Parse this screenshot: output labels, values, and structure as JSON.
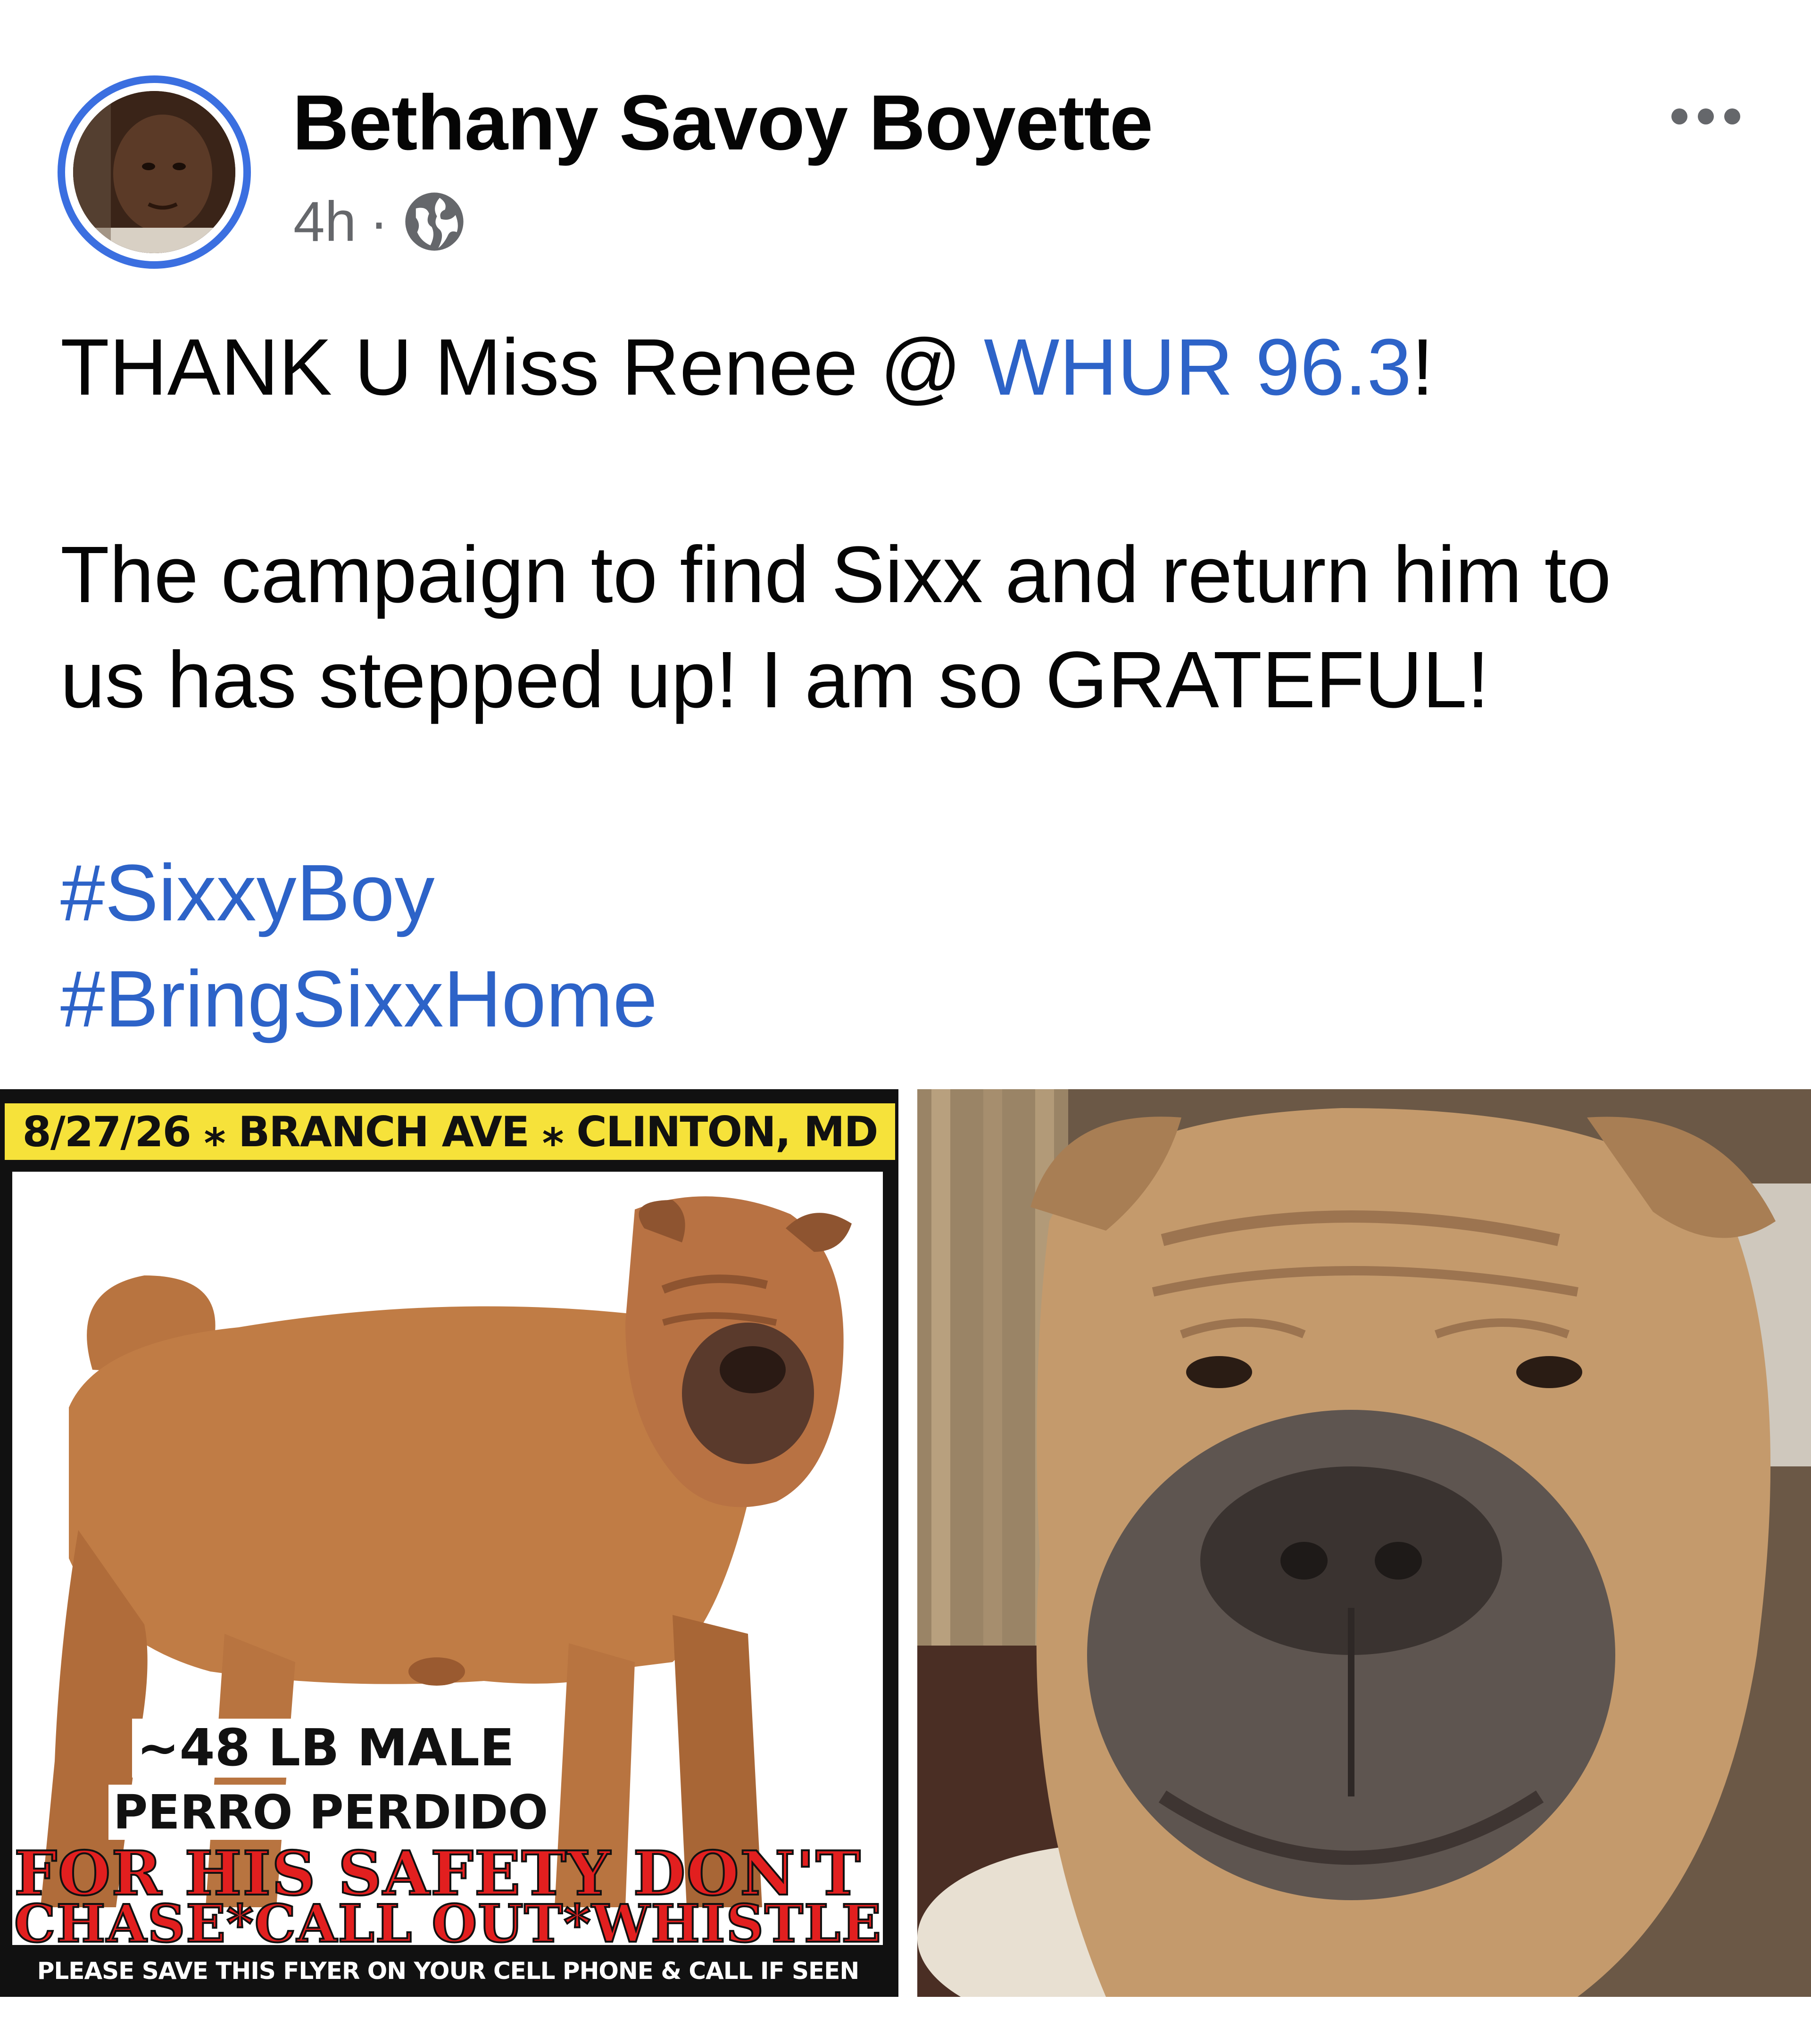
{
  "post": {
    "author_name": "Bethany Savoy Boyette",
    "timestamp": "4h",
    "separator": "·",
    "privacy_icon": "globe-icon",
    "more_icon": "ellipsis-icon",
    "text_line1_prefix": "THANK U Miss Renee @ ",
    "text_line1_link": "WHUR 96.3",
    "text_line1_suffix": "!",
    "text_line2": "The campaign to find Sixx and return him to",
    "text_line3": "us has stepped up! I am so GRATEFUL!",
    "hashtags": [
      "#SixxyBoy",
      "#BringSixxHome"
    ]
  },
  "flyer": {
    "header": "8/27/26 ⁎ BRANCH AVE ⁎ CLINTON, MD",
    "weight": "~48 LB MALE",
    "perro": "PERRO PERDIDO",
    "warning_line1": "FOR HIS SAFETY DON'T",
    "warning_line2": "CHASE*CALL OUT*WHISTLE",
    "footer": "PLEASE SAVE THIS FLYER ON YOUR CELL PHONE & CALL IF SEEN"
  },
  "colors": {
    "link": "#2d63c8",
    "avatar_ring": "#3b6fe0",
    "flyer_header_bg": "#f6e23a",
    "warning_red": "#e21f1f",
    "meta_gray": "#65676b"
  }
}
